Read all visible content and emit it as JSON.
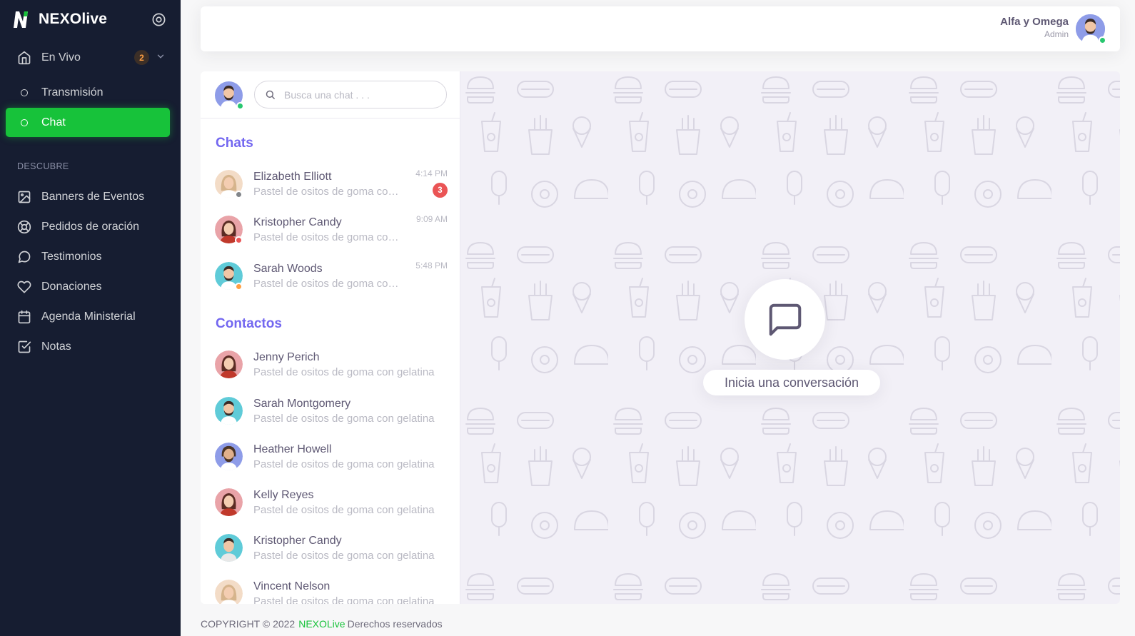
{
  "app": {
    "name": "NEXOlive"
  },
  "colors": {
    "accent": "#17c23a",
    "sidebar_bg": "#161d31",
    "section": "#7367f0",
    "badge_red": "#ea5455",
    "badge_warning": "#ff9f43"
  },
  "sidebar": {
    "live": {
      "label": "En Vivo",
      "badge": "2",
      "icon": "home-icon"
    },
    "sub_items": [
      {
        "label": "Transmisión",
        "icon": "circle-icon",
        "active": false
      },
      {
        "label": "Chat",
        "icon": "circle-icon",
        "active": true
      }
    ],
    "section_header": "DESCUBRE",
    "items": [
      {
        "label": "Banners de Eventos",
        "icon": "image-icon"
      },
      {
        "label": "Pedidos de oración",
        "icon": "life-buoy-icon"
      },
      {
        "label": "Testimonios",
        "icon": "message-circle-icon"
      },
      {
        "label": "Donaciones",
        "icon": "heart-icon"
      },
      {
        "label": "Agenda Ministerial",
        "icon": "calendar-icon"
      },
      {
        "label": "Notas",
        "icon": "check-square-icon"
      }
    ]
  },
  "header": {
    "user_name": "Alfa y Omega",
    "user_role": "Admin"
  },
  "chat": {
    "search_placeholder": "Busca una chat . . .",
    "chats_title": "Chats",
    "contacts_title": "Contactos",
    "chats": [
      {
        "name": "Elizabeth Elliott",
        "message": "Pastel de ositos de goma con gelatina",
        "time": "4:14 PM",
        "unread": "3",
        "status": "offline"
      },
      {
        "name": "Kristopher Candy",
        "message": "Pastel de ositos de goma con gelatina",
        "time": "9:09 AM",
        "unread": "",
        "status": "busy"
      },
      {
        "name": "Sarah Woods",
        "message": "Pastel de ositos de goma con gelatina",
        "time": "5:48 PM",
        "unread": "",
        "status": "away"
      }
    ],
    "contacts": [
      {
        "name": "Jenny Perich",
        "message": "Pastel de ositos de goma con gelatina"
      },
      {
        "name": "Sarah Montgomery",
        "message": "Pastel de ositos de goma con gelatina"
      },
      {
        "name": "Heather Howell",
        "message": "Pastel de ositos de goma con gelatina"
      },
      {
        "name": "Kelly Reyes",
        "message": "Pastel de ositos de goma con gelatina"
      },
      {
        "name": "Kristopher Candy",
        "message": "Pastel de ositos de goma con gelatina"
      },
      {
        "name": "Vincent Nelson",
        "message": "Pastel de ositos de goma con gelatina"
      }
    ],
    "start_label": "Inicia una conversación"
  },
  "footer": {
    "copyright": "COPYRIGHT © 2022",
    "brand": "NEXOLive",
    "rights": "Derechos reservados"
  }
}
